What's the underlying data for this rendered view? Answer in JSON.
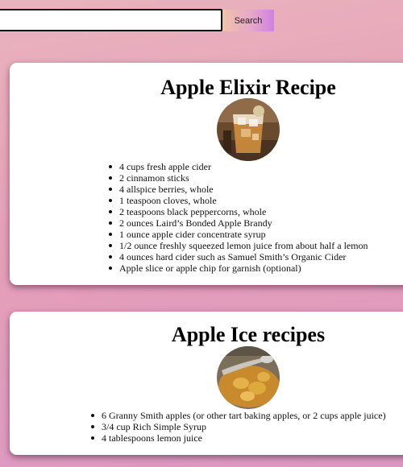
{
  "search": {
    "placeholder": "",
    "value": "",
    "button_label": "Search"
  },
  "recipes": [
    {
      "title": "Apple Elixir Recipe",
      "photo_icon": "iced-cocktail-photo",
      "ingredients": [
        "4 cups fresh apple cider",
        "2 cinnamon sticks",
        "4 allspice berries, whole",
        "1 teaspoon cloves, whole",
        "2 teaspoons black peppercorns, whole",
        "2 ounces Laird’s Bonded Apple Brandy",
        "1 ounce apple cider concentrate syrup",
        "1/2 ounce freshly squeezed lemon juice from about half a lemon",
        "4 ounces hard cider such as Samuel Smith’s Organic Cider",
        "Apple slice or apple chip for garnish (optional)"
      ]
    },
    {
      "title": "Apple Ice recipes",
      "photo_icon": "apple-ice-dessert-photo",
      "ingredients": [
        "6 Granny Smith apples (or other tart baking apples, or 2 cups apple juice)",
        "3/4 cup Rich Simple Syrup",
        "4 tablespoons lemon juice"
      ]
    }
  ],
  "colors": {
    "background_top": "#e9b3bd",
    "background_bottom": "#dc98c2",
    "button_gradient_start": "#f0c3a9",
    "button_gradient_end": "#cf82e2"
  }
}
